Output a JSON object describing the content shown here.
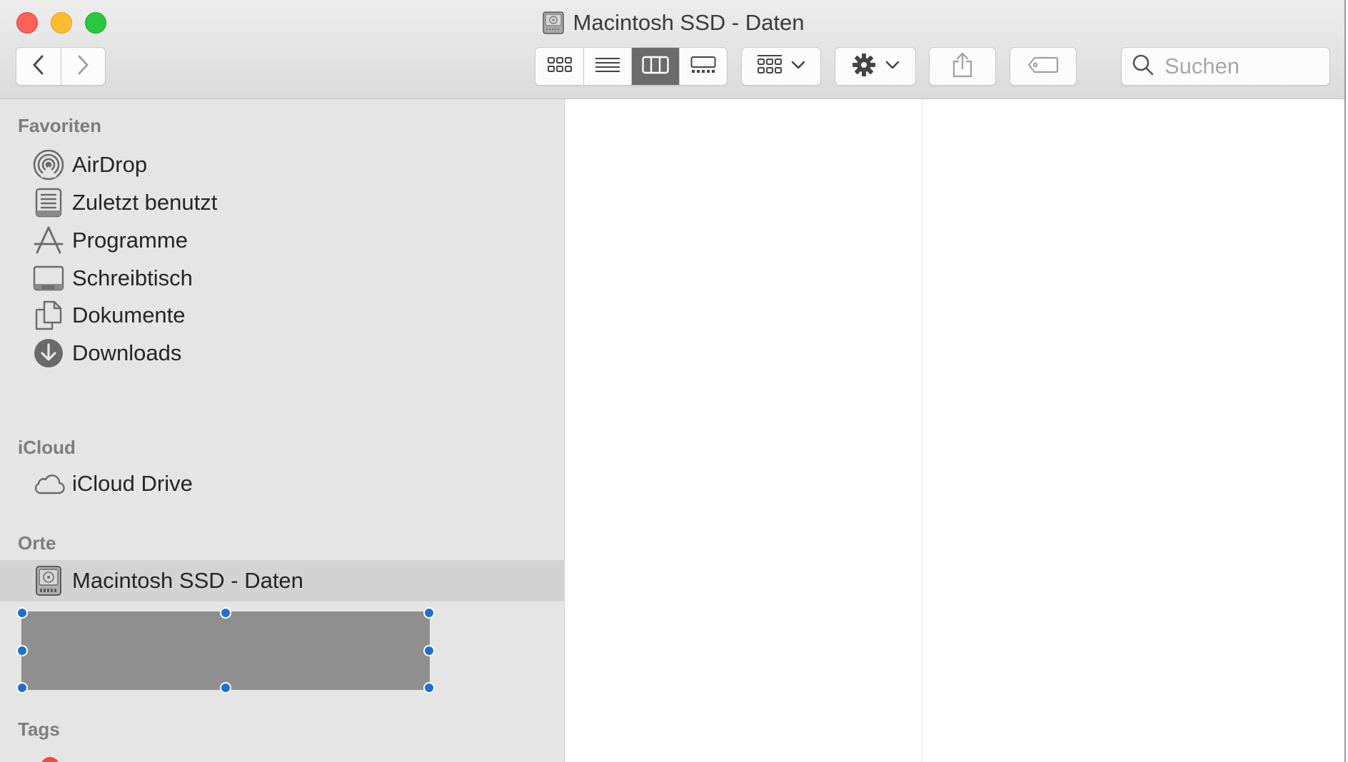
{
  "window": {
    "title": "Macintosh SSD - Daten",
    "title_icon": "internal-disk-icon"
  },
  "toolbar": {
    "back_icon": "chevron-left-icon",
    "forward_icon": "chevron-right-icon",
    "view_modes": [
      {
        "name": "icon-view",
        "icon": "grid-icon",
        "active": false
      },
      {
        "name": "list-view",
        "icon": "list-icon",
        "active": false
      },
      {
        "name": "column-view",
        "icon": "columns-icon",
        "active": true
      },
      {
        "name": "gallery-view",
        "icon": "gallery-icon",
        "active": false
      }
    ],
    "group_icon": "group-grid-icon",
    "action_icon": "gear-icon",
    "share_icon": "share-icon",
    "tag_icon": "tag-icon",
    "search": {
      "placeholder": "Suchen",
      "value": ""
    }
  },
  "sidebar": {
    "favorites_header": "Favoriten",
    "favorites": [
      {
        "label": "AirDrop",
        "icon": "airdrop-icon"
      },
      {
        "label": "Zuletzt benutzt",
        "icon": "recents-icon"
      },
      {
        "label": "Programme",
        "icon": "applications-icon"
      },
      {
        "label": "Schreibtisch",
        "icon": "desktop-icon"
      },
      {
        "label": "Dokumente",
        "icon": "documents-icon"
      },
      {
        "label": "Downloads",
        "icon": "downloads-icon"
      }
    ],
    "icloud_header": "iCloud",
    "icloud": [
      {
        "label": "iCloud Drive",
        "icon": "cloud-icon"
      }
    ],
    "locations_header": "Orte",
    "locations": [
      {
        "label": "Macintosh SSD - Daten",
        "icon": "internal-disk-icon",
        "selected": true
      }
    ],
    "tags_header": "Tags",
    "tags": [
      {
        "color": "#ef4a3f"
      }
    ]
  },
  "colors": {
    "selection": "#d3d3d3",
    "sidebar_bg": "#e5e5e5",
    "handle": "#1f6fd0",
    "redaction": "#8f8f8f"
  }
}
